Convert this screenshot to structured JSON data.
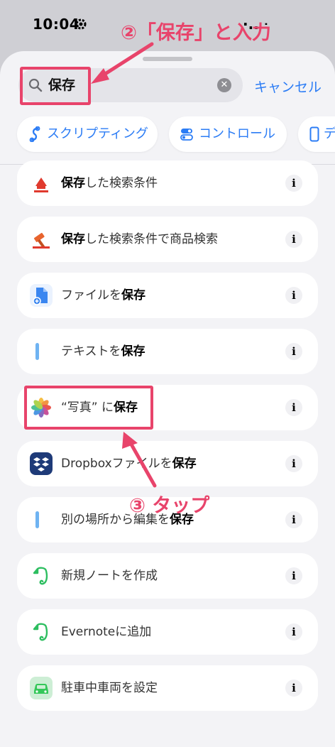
{
  "status": {
    "time": "10:04",
    "right": "·.. ᐧ"
  },
  "search": {
    "value": "保存",
    "clear": "✕",
    "cancel": "キャンセル"
  },
  "chips": [
    {
      "label": "スクリプティング",
      "icon": "scripting-icon"
    },
    {
      "label": "コントロール",
      "icon": "controls-icon"
    },
    {
      "label": "デ",
      "icon": "device-icon"
    }
  ],
  "actions": [
    {
      "bold_pre": "保存",
      "text": "した検索条件",
      "bold_post": "",
      "icon": "yahoo-auction-icon"
    },
    {
      "bold_pre": "保存",
      "text": "した検索条件で商品検索",
      "bold_post": "",
      "icon": "yahoo-auction-icon"
    },
    {
      "bold_pre": "",
      "text": "ファイルを",
      "bold_post": "保存",
      "icon": "files-icon"
    },
    {
      "bold_pre": "",
      "text": "テキストを",
      "bold_post": "保存",
      "icon": "text-icon"
    },
    {
      "bold_pre": "",
      "text": "“写真” に",
      "bold_post": "保存",
      "icon": "photos-icon"
    },
    {
      "bold_pre": "",
      "text": "Dropboxファイルを",
      "bold_post": "保存",
      "icon": "dropbox-icon"
    },
    {
      "bold_pre": "",
      "text": "別の場所から編集を",
      "bold_post": "保存",
      "icon": "text-icon"
    },
    {
      "bold_pre": "",
      "text": "新規ノートを作成",
      "bold_post": "",
      "icon": "evernote-icon"
    },
    {
      "bold_pre": "",
      "text": "Evernoteに追加",
      "bold_post": "",
      "icon": "evernote-icon"
    },
    {
      "bold_pre": "",
      "text": "駐車中車両を設定",
      "bold_post": "",
      "icon": "car-icon"
    }
  ],
  "info_label": "i",
  "annotations": {
    "step2": "②「保存」と入力",
    "step3": "③ タップ",
    "color": "#e8446b"
  }
}
